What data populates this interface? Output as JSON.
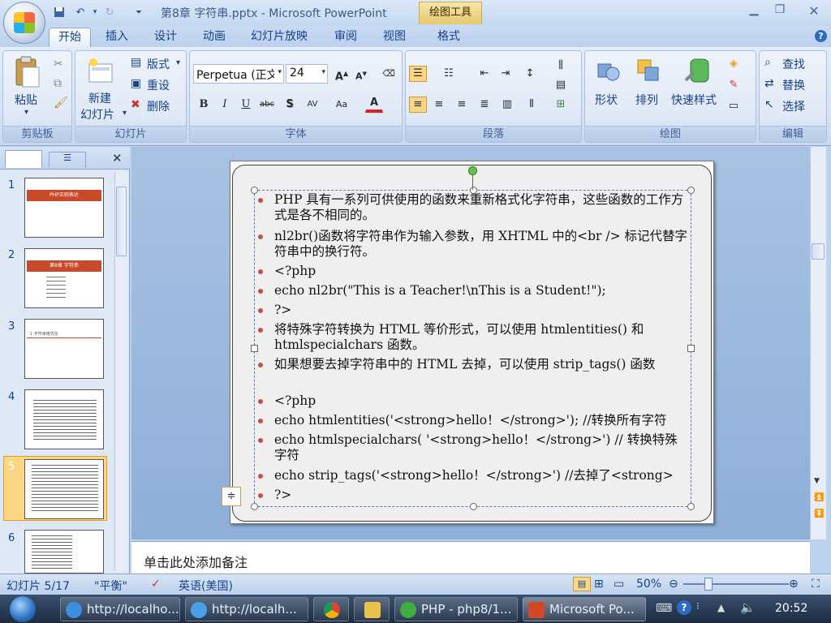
{
  "window": {
    "title": "第8章 字符串.pptx - Microsoft PowerPoint",
    "contextual_tab": "绘图工具"
  },
  "ribbon_tabs": [
    "开始",
    "插入",
    "设计",
    "动画",
    "幻灯片放映",
    "审阅",
    "视图",
    "格式"
  ],
  "ribbon": {
    "clipboard": {
      "label": "剪贴板",
      "paste": "粘贴"
    },
    "slides": {
      "label": "幻灯片",
      "new_slide_1": "新建",
      "new_slide_2": "幻灯片",
      "layout": "版式",
      "reset": "重设",
      "delete": "删除"
    },
    "font": {
      "label": "字体",
      "name": "Perpetua (正文",
      "size": "24"
    },
    "paragraph": {
      "label": "段落"
    },
    "drawing": {
      "label": "绘图",
      "shapes": "形状",
      "arrange": "排列",
      "quick_styles": "快速样式"
    },
    "editing": {
      "label": "编辑",
      "find": "查找",
      "replace": "替换",
      "select": "选择"
    }
  },
  "slides_pane": {
    "numbers": [
      "1",
      "2",
      "3",
      "4",
      "5",
      "6"
    ],
    "selected": 5,
    "thumb_titles": [
      "PHP正则表达",
      "第8章 字符串",
      "1.字符串格式化",
      "",
      "",
      ""
    ]
  },
  "slide": {
    "bullets": [
      "PHP 具有一系列可供使用的函数来重新格式化字符串，这些函数的工作方式是各不相同的。",
      "nl2br()函数将字符串作为输入参数，用 XHTML 中的<br /> 标记代替字符串中的换行符。",
      "<?php",
      "echo nl2br(\"This is a Teacher!\\nThis is a Student!\");",
      "?>",
      "将特殊字符转换为 HTML 等价形式，可以使用 htmlentities() 和 htmlspecialchars 函数。",
      "如果想要去掉字符串中的 HTML 去掉，可以使用 strip_tags() 函数",
      "<?php",
      "echo htmlentities('<strong>hello！</strong>'); //转换所有字符",
      "echo htmlspecialchars( '<strong>hello！</strong>') // 转换特殊字符",
      "echo strip_tags('<strong>hello！</strong>') //去掉了<strong>",
      "?>"
    ]
  },
  "notes": {
    "placeholder": "单击此处添加备注"
  },
  "status": {
    "slide": "幻灯片 5/17",
    "theme": "\"平衡\"",
    "language": "英语(美国)",
    "zoom": "50%"
  },
  "taskbar": {
    "items": [
      "http://localho...",
      "http://localh...",
      "",
      "",
      "PHP - php8/1...",
      "Microsoft Po..."
    ],
    "time": "20:52"
  },
  "colors": {
    "accent": "#15428b",
    "bullet": "#c0504d",
    "thumb_header": "#c94a2a"
  }
}
